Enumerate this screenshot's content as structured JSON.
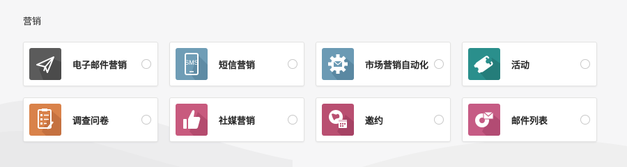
{
  "section": {
    "title": "营销"
  },
  "apps": [
    {
      "label": "电子邮件营销",
      "icon": "paper-plane-icon",
      "color": "#5b5b5b"
    },
    {
      "label": "短信营销",
      "icon": "sms-phone-icon",
      "color": "#6f9db6"
    },
    {
      "label": "市场营销自动化",
      "icon": "gear-envelope-icon",
      "color": "#6b9ab4"
    },
    {
      "label": "活动",
      "icon": "ticket-icon",
      "color": "#2a8f8c"
    },
    {
      "label": "调查问卷",
      "icon": "survey-clipboard-icon",
      "color": "#d9824a"
    },
    {
      "label": "社媒营销",
      "icon": "thumbs-up-icon",
      "color": "#c85a7e"
    },
    {
      "label": "邀约",
      "icon": "globe-calendar-icon",
      "color": "#b94f71"
    },
    {
      "label": "邮件列表",
      "icon": "mailing-list-icon",
      "color": "#c65b84"
    }
  ]
}
